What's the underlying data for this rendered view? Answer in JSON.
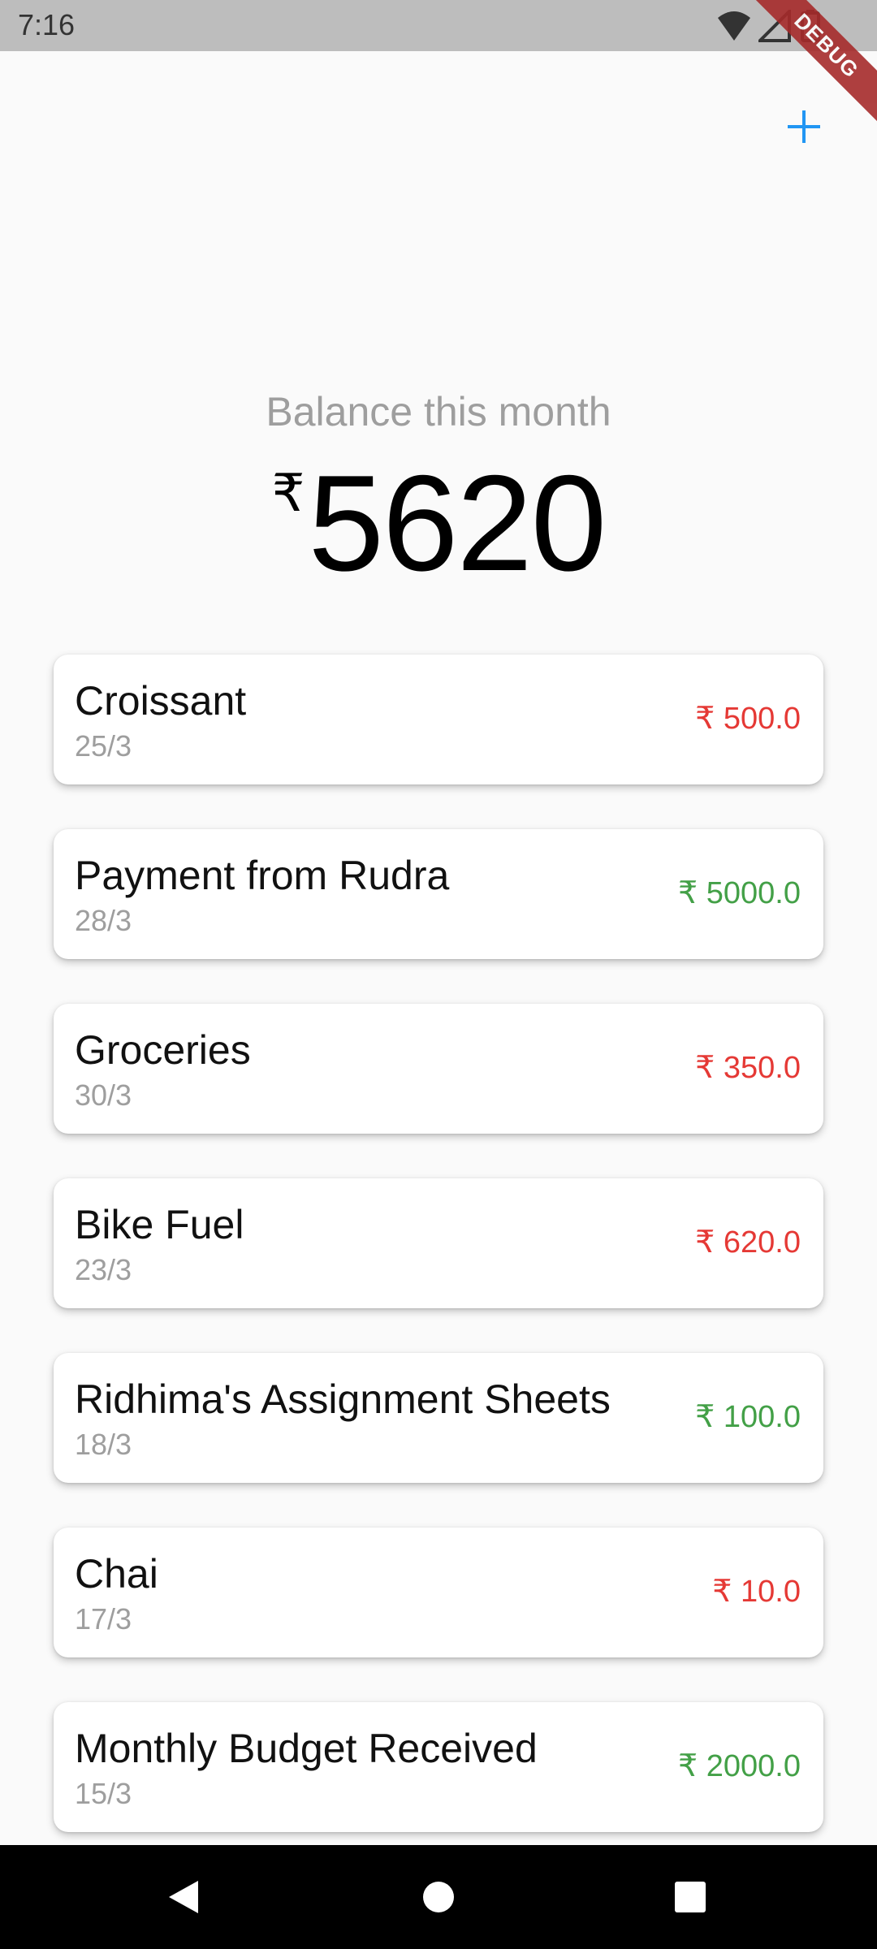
{
  "status_bar": {
    "time": "7:16",
    "icons": [
      "wifi-icon",
      "signal-icon",
      "battery-icon"
    ]
  },
  "debug_banner": "DEBUG",
  "header": {
    "add_icon": "plus-icon",
    "accent_color": "#2196f3"
  },
  "balance": {
    "label": "Balance this month",
    "currency": "₹",
    "amount": "5620"
  },
  "colors": {
    "debit": "#e53935",
    "credit": "#43a047"
  },
  "transactions": [
    {
      "title": "Croissant",
      "date": "25/3",
      "amount": "₹ 500.0",
      "type": "debit"
    },
    {
      "title": "Payment from Rudra",
      "date": "28/3",
      "amount": "₹ 5000.0",
      "type": "credit"
    },
    {
      "title": "Groceries",
      "date": "30/3",
      "amount": "₹ 350.0",
      "type": "debit"
    },
    {
      "title": "Bike Fuel",
      "date": "23/3",
      "amount": "₹ 620.0",
      "type": "debit"
    },
    {
      "title": "Ridhima's Assignment Sheets",
      "date": "18/3",
      "amount": "₹ 100.0",
      "type": "credit"
    },
    {
      "title": "Chai",
      "date": "17/3",
      "amount": "₹ 10.0",
      "type": "debit"
    },
    {
      "title": "Monthly Budget Received",
      "date": "15/3",
      "amount": "₹ 2000.0",
      "type": "credit"
    }
  ],
  "nav_bar": {
    "back_icon": "back-triangle-icon",
    "home_icon": "home-circle-icon",
    "recents_icon": "recents-square-icon"
  }
}
